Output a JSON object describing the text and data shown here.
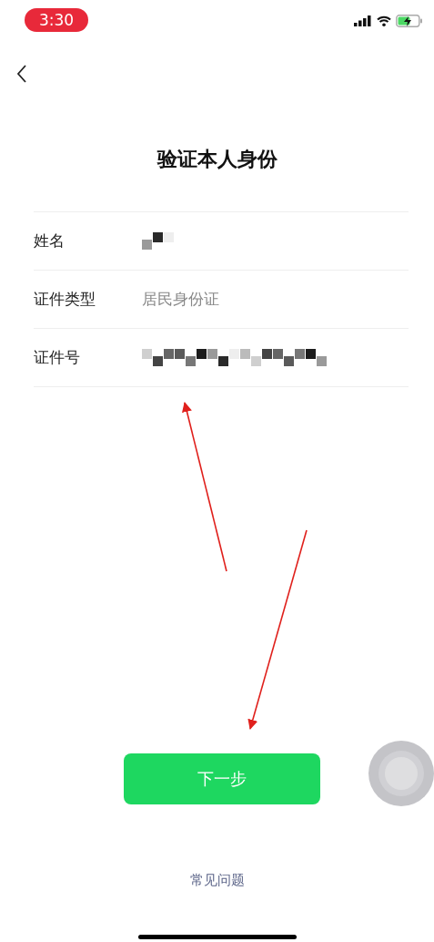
{
  "status_bar": {
    "time": "3:30"
  },
  "title": "验证本人身份",
  "fields": [
    {
      "label": "姓名",
      "kind": "masked"
    },
    {
      "label": "证件类型",
      "kind": "text",
      "value": "居民身份证"
    },
    {
      "label": "证件号",
      "kind": "masked"
    }
  ],
  "primary_button": "下一步",
  "help_link": "常见问题"
}
